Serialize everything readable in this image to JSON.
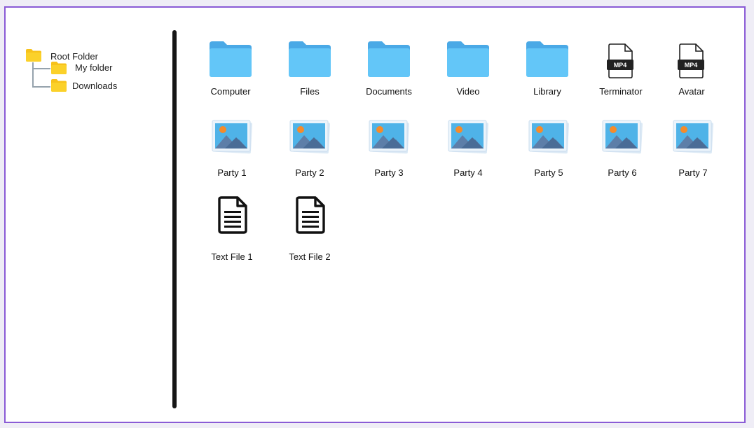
{
  "tree": {
    "root": {
      "label": "Root Folder",
      "icon": "folder-icon"
    },
    "children": [
      {
        "label": "My folder",
        "icon": "folder-icon"
      },
      {
        "label": "Downloads",
        "icon": "folder-icon"
      }
    ]
  },
  "grid": {
    "row1": [
      {
        "label": "Computer",
        "icon": "folder-icon"
      },
      {
        "label": "Files",
        "icon": "folder-icon"
      },
      {
        "label": "Documents",
        "icon": "folder-icon"
      },
      {
        "label": "Video",
        "icon": "folder-icon"
      },
      {
        "label": "Library",
        "icon": "folder-icon"
      },
      {
        "label": "Terminator",
        "icon": "mp4-file-icon",
        "badge": "MP4"
      },
      {
        "label": "Avatar",
        "icon": "mp4-file-icon",
        "badge": "MP4"
      }
    ],
    "row2": [
      {
        "label": "Party 1",
        "icon": "image-file-icon"
      },
      {
        "label": "Party 2",
        "icon": "image-file-icon"
      },
      {
        "label": "Party 3",
        "icon": "image-file-icon"
      },
      {
        "label": "Party 4",
        "icon": "image-file-icon"
      },
      {
        "label": "Party 5",
        "icon": "image-file-icon"
      },
      {
        "label": "Party 6",
        "icon": "image-file-icon"
      },
      {
        "label": "Party 7",
        "icon": "image-file-icon"
      }
    ],
    "row3": [
      {
        "label": "Text File 1",
        "icon": "text-file-icon"
      },
      {
        "label": "Text File 2",
        "icon": "text-file-icon"
      }
    ]
  },
  "colors": {
    "frame_border": "#8a5bd6",
    "tree_folder": "#f7c21b",
    "grid_folder": "#63c6f8",
    "divider": "#161616"
  }
}
